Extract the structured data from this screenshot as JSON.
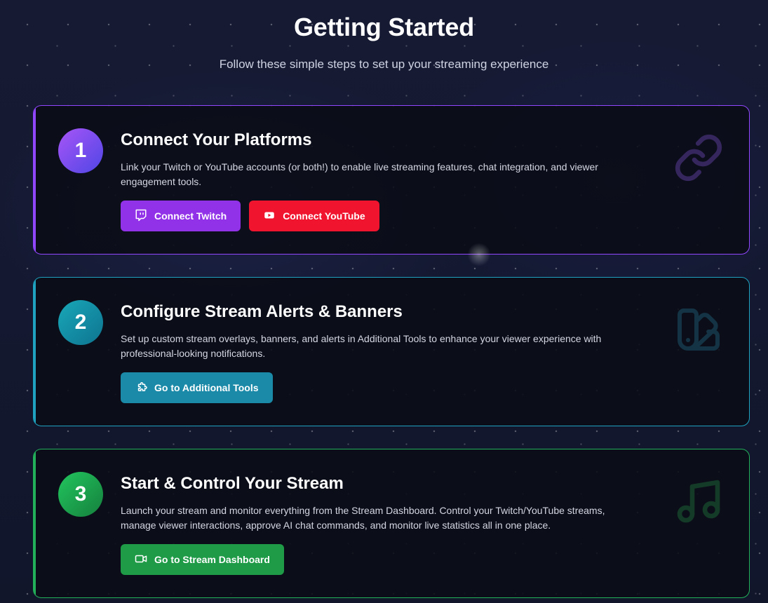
{
  "header": {
    "title": "Getting Started",
    "subtitle": "Follow these simple steps to set up your streaming experience"
  },
  "steps": [
    {
      "number": "1",
      "title": "Connect Your Platforms",
      "description": "Link your Twitch or YouTube accounts (or both!) to enable live streaming features, chat integration, and viewer engagement tools.",
      "accent": "#9146ff",
      "deco_icon": "link-icon",
      "buttons": [
        {
          "label": "Connect Twitch",
          "icon": "twitch-icon",
          "color": "#9131e8"
        },
        {
          "label": "Connect YouTube",
          "icon": "youtube-icon",
          "color": "#f0142f"
        }
      ]
    },
    {
      "number": "2",
      "title": "Configure Stream Alerts & Banners",
      "description": "Set up custom stream overlays, banners, and alerts in Additional Tools to enhance your viewer experience with professional-looking notifications.",
      "accent": "#1ea2bf",
      "deco_icon": "swatch-book-icon",
      "buttons": [
        {
          "label": "Go to Additional Tools",
          "icon": "puzzle-icon",
          "color": "#1a8aa8"
        }
      ]
    },
    {
      "number": "3",
      "title": "Start & Control Your Stream",
      "description": "Launch your stream and monitor everything from the Stream Dashboard. Control your Twitch/YouTube streams, manage viewer interactions, approve AI chat commands, and monitor live statistics all in one place.",
      "accent": "#22b15a",
      "deco_icon": "music-icon",
      "buttons": [
        {
          "label": "Go to Stream Dashboard",
          "icon": "video-icon",
          "color": "#1f9a47"
        }
      ]
    }
  ]
}
